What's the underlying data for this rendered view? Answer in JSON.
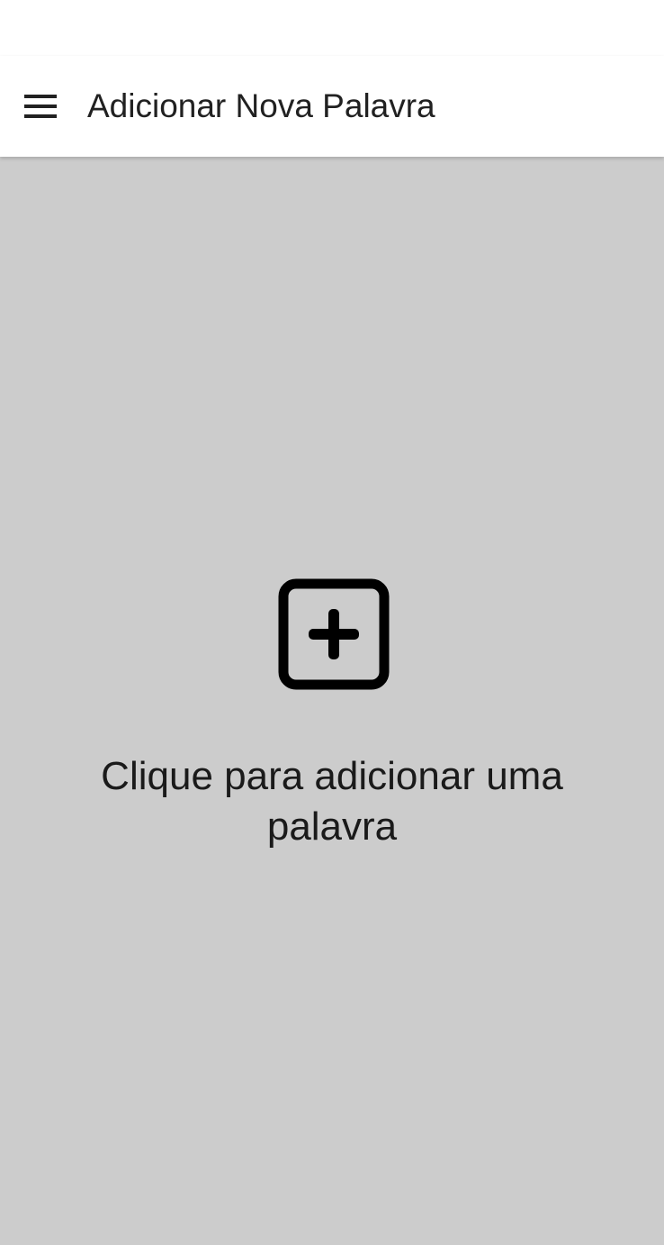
{
  "app_bar": {
    "title": "Adicionar Nova Palavra",
    "menu_icon": "hamburger-menu-icon"
  },
  "main": {
    "add_icon": "add-box-icon",
    "prompt": "Clique para adicionar uma palavra"
  },
  "colors": {
    "app_bar_background": "#ffffff",
    "content_background": "#cccccc",
    "icon_color": "#000000",
    "text_color": "#1a1a1a"
  }
}
